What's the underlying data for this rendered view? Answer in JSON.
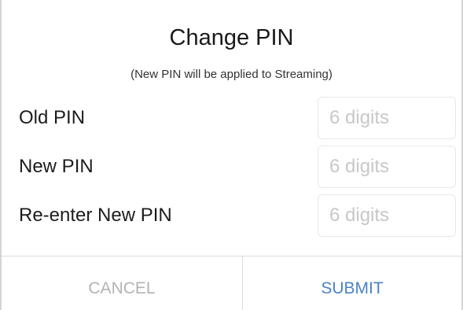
{
  "dialog": {
    "title": "Change PIN",
    "subtitle": "(New PIN will be applied to Streaming)"
  },
  "fields": {
    "old_pin": {
      "label": "Old PIN",
      "placeholder": "6 digits",
      "value": ""
    },
    "new_pin": {
      "label": "New PIN",
      "placeholder": "6 digits",
      "value": ""
    },
    "reenter_pin": {
      "label": "Re-enter New PIN",
      "placeholder": "6 digits",
      "value": ""
    }
  },
  "actions": {
    "cancel_label": "CANCEL",
    "submit_label": "SUBMIT"
  },
  "colors": {
    "submit_accent": "#4a82c4",
    "cancel_disabled": "#b3b3b3",
    "placeholder": "#c8c8c8"
  }
}
